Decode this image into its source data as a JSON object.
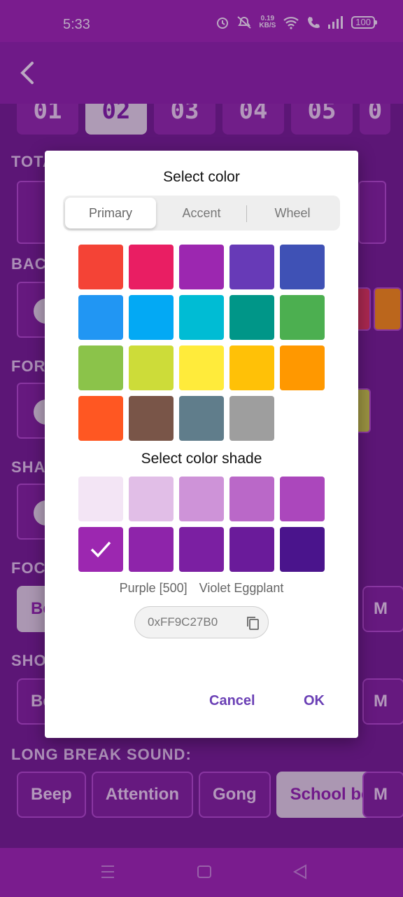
{
  "status_bar": {
    "time": "5:33",
    "net_speed_value": "0.19",
    "net_speed_unit": "KB/S",
    "battery": "100"
  },
  "background": {
    "number_buttons": [
      "01",
      "02",
      "03",
      "04",
      "05",
      "0"
    ],
    "selected_number_index": 1,
    "labels": {
      "total": "TOTA",
      "background": "BACK",
      "foreground": "FORE",
      "shadow": "SHAD",
      "focus": "FOCU",
      "short": "SHOR",
      "long_break": "LONG BREAK SOUND:"
    },
    "focus_sound_first": "Be",
    "short_sound_first": "Be",
    "partial_sound_label": "M",
    "long_break_sounds": [
      "Beep",
      "Attention",
      "Gong",
      "School bell",
      "M"
    ],
    "long_break_selected_index": 3
  },
  "dialog": {
    "title": "Select color",
    "tabs": [
      "Primary",
      "Accent",
      "Wheel"
    ],
    "active_tab_index": 0,
    "primary_colors": [
      "#f44336",
      "#e91e63",
      "#9c27b0",
      "#673ab7",
      "#3f51b5",
      "#2196f3",
      "#03a9f4",
      "#00bcd4",
      "#009688",
      "#4caf50",
      "#8bc34a",
      "#cddc39",
      "#ffeb3b",
      "#ffc107",
      "#ff9800",
      "#ff5722",
      "#795548",
      "#607d8b",
      "#9e9e9e"
    ],
    "shade_title": "Select color shade",
    "shades": [
      "#f3e5f5",
      "#e1bee7",
      "#ce93d8",
      "#ba68c8",
      "#ab47bc",
      "#9c27b0",
      "#8e24aa",
      "#7b1fa2",
      "#6a1b9a",
      "#4a148c"
    ],
    "selected_shade_index": 5,
    "color_name": "Purple [500]",
    "color_alias": "Violet Eggplant",
    "hex_value": "0xFF9C27B0",
    "cancel_label": "Cancel",
    "ok_label": "OK"
  }
}
